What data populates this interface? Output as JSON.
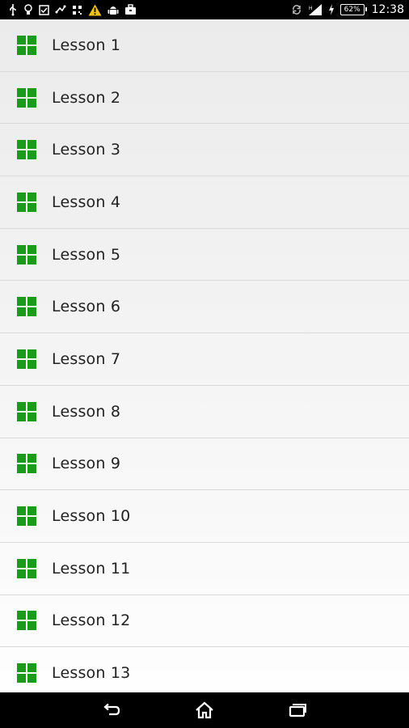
{
  "status_bar": {
    "time": "12:38",
    "battery_percent": "62%",
    "left_icons": [
      "usb-icon",
      "bulb-icon",
      "checkbox-icon",
      "transfer-icon",
      "qr-icon",
      "warning-icon",
      "android-icon",
      "briefcase-icon"
    ],
    "right_icons": [
      "sync-icon",
      "signal-icon",
      "charging-icon",
      "battery-icon"
    ]
  },
  "lessons": [
    {
      "label": "Lesson 1"
    },
    {
      "label": "Lesson 2"
    },
    {
      "label": "Lesson 3"
    },
    {
      "label": "Lesson 4"
    },
    {
      "label": "Lesson 5"
    },
    {
      "label": "Lesson 6"
    },
    {
      "label": "Lesson 7"
    },
    {
      "label": "Lesson 8"
    },
    {
      "label": "Lesson 9"
    },
    {
      "label": "Lesson 10"
    },
    {
      "label": "Lesson 11"
    },
    {
      "label": "Lesson 12"
    },
    {
      "label": "Lesson 13"
    }
  ],
  "icon_name": "grid-icon",
  "colors": {
    "icon_green": "#1c9a1c",
    "text": "#222222",
    "divider": "#d9d9d9",
    "bar_background": "#000000"
  },
  "nav_bar": [
    "back-icon",
    "home-icon",
    "recents-icon"
  ]
}
